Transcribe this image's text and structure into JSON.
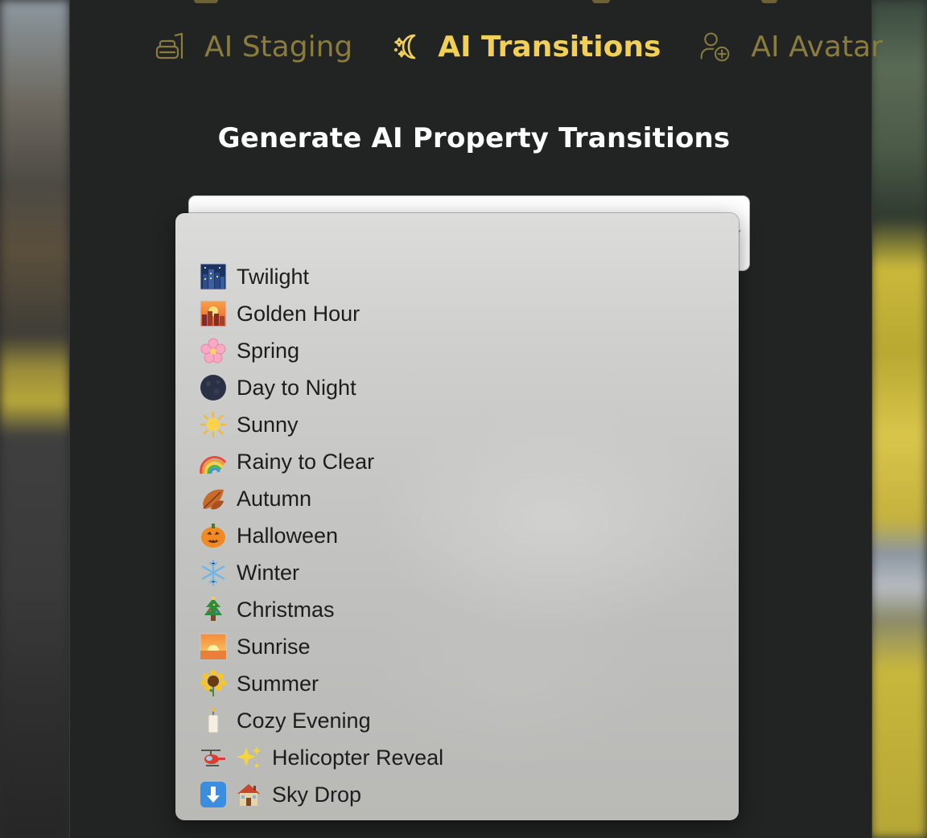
{
  "tabs": [
    {
      "label": "AI Staging",
      "icon": "sofa-icon",
      "active": false
    },
    {
      "label": "AI Transitions",
      "icon": "sparkle-moon-icon",
      "active": true
    },
    {
      "label": "AI Avatar",
      "icon": "user-plus-icon",
      "active": false
    }
  ],
  "heading": "Generate AI Property Transitions",
  "menu": {
    "items": [
      {
        "label": "Twilight",
        "icons": [
          "city-night-icon"
        ]
      },
      {
        "label": "Golden Hour",
        "icons": [
          "city-sunset-icon"
        ]
      },
      {
        "label": "Spring",
        "icons": [
          "cherry-blossom-icon"
        ]
      },
      {
        "label": "Day to Night",
        "icons": [
          "new-moon-icon"
        ]
      },
      {
        "label": "Sunny",
        "icons": [
          "sun-icon"
        ]
      },
      {
        "label": "Rainy to Clear",
        "icons": [
          "rainbow-icon"
        ]
      },
      {
        "label": "Autumn",
        "icons": [
          "fallen-leaf-icon"
        ]
      },
      {
        "label": "Halloween",
        "icons": [
          "jack-o-lantern-icon"
        ]
      },
      {
        "label": "Winter",
        "icons": [
          "snowflake-icon"
        ]
      },
      {
        "label": "Christmas",
        "icons": [
          "christmas-tree-icon"
        ]
      },
      {
        "label": "Sunrise",
        "icons": [
          "sunrise-icon"
        ]
      },
      {
        "label": "Summer",
        "icons": [
          "sunflower-icon"
        ]
      },
      {
        "label": "Cozy Evening",
        "icons": [
          "candle-icon"
        ]
      },
      {
        "label": "Helicopter Reveal",
        "icons": [
          "helicopter-icon",
          "sparkles-icon"
        ]
      },
      {
        "label": "Sky Drop",
        "icons": [
          "down-arrow-icon",
          "house-icon"
        ]
      }
    ]
  },
  "colors": {
    "accent": "#f2cf57",
    "tab_inactive": "#8a7c3d",
    "panel": "#222424"
  }
}
